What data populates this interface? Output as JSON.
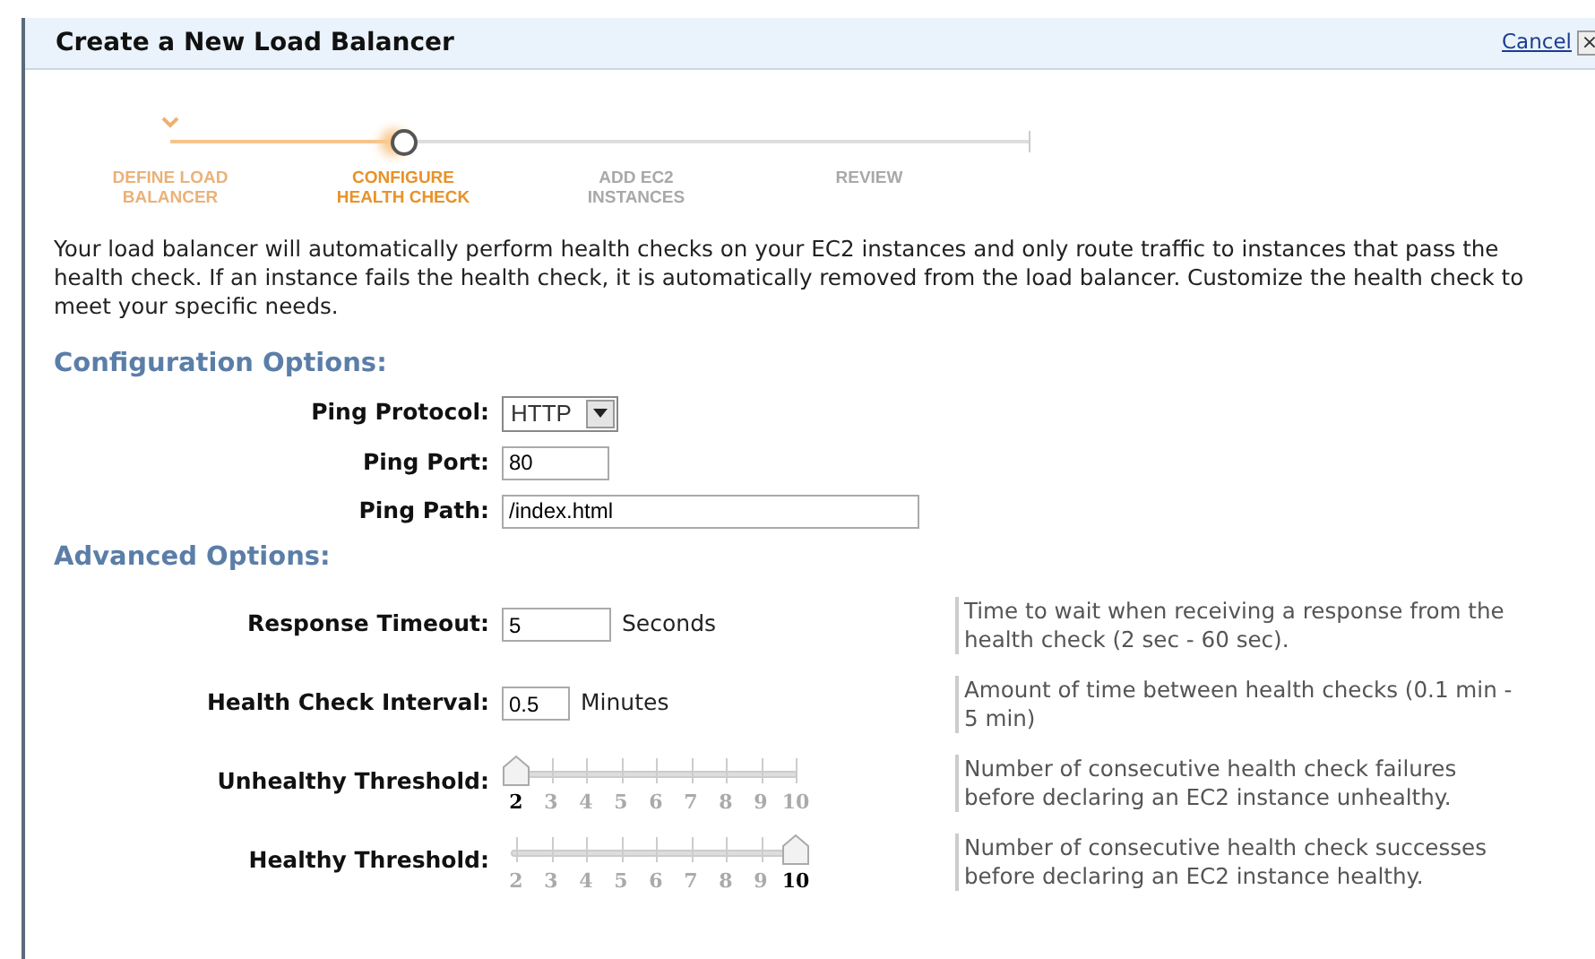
{
  "dialog": {
    "title": "Create a New Load Balancer",
    "cancel": "Cancel",
    "close": "×"
  },
  "steps": [
    {
      "label": "DEFINE LOAD BALANCER",
      "done": true,
      "selected": false
    },
    {
      "label": "CONFIGURE HEALTH CHECK",
      "done": false,
      "selected": true
    },
    {
      "label": "ADD EC2 INSTANCES",
      "done": false,
      "selected": false
    },
    {
      "label": "REVIEW",
      "done": false,
      "selected": false
    }
  ],
  "intro": "Your load balancer will automatically perform health checks on your EC2 instances and only route traffic to instances that pass the health check. If an instance fails the health check, it is automatically removed from the load balancer. Customize the health check to meet your specific needs.",
  "configuration": {
    "heading": "Configuration Options:",
    "fields": [
      {
        "kind": "select",
        "label": "Ping Protocol:",
        "value": "HTTP"
      },
      {
        "kind": "text",
        "label": "Ping Port:",
        "value": "80"
      },
      {
        "kind": "text",
        "label": "Ping Path:",
        "value": "/index.html"
      }
    ]
  },
  "advanced": {
    "heading": "Advanced Options:",
    "fields": [
      {
        "kind": "text",
        "label": "Response Timeout:",
        "value": "5",
        "unit": "Seconds",
        "help": "Time to wait when receiving a response from the health check (2 sec - 60 sec)."
      },
      {
        "kind": "text",
        "label": "Health Check Interval:",
        "value": "0.5",
        "unit": "Minutes",
        "help": "Amount of time between health checks (0.1 min - 5 min)"
      },
      {
        "kind": "slider",
        "label": "Unhealthy Threshold:",
        "ticks": [
          "2",
          "3",
          "4",
          "5",
          "6",
          "7",
          "8",
          "9",
          "10"
        ],
        "level": 0,
        "help": "Number of consecutive health check failures before declaring an EC2 instance unhealthy."
      },
      {
        "kind": "slider",
        "label": "Healthy Threshold:",
        "ticks": [
          "2",
          "3",
          "4",
          "5",
          "6",
          "7",
          "8",
          "9",
          "10"
        ],
        "level": 1,
        "help": "Number of consecutive health check successes before declaring an EC2 instance healthy."
      }
    ]
  }
}
